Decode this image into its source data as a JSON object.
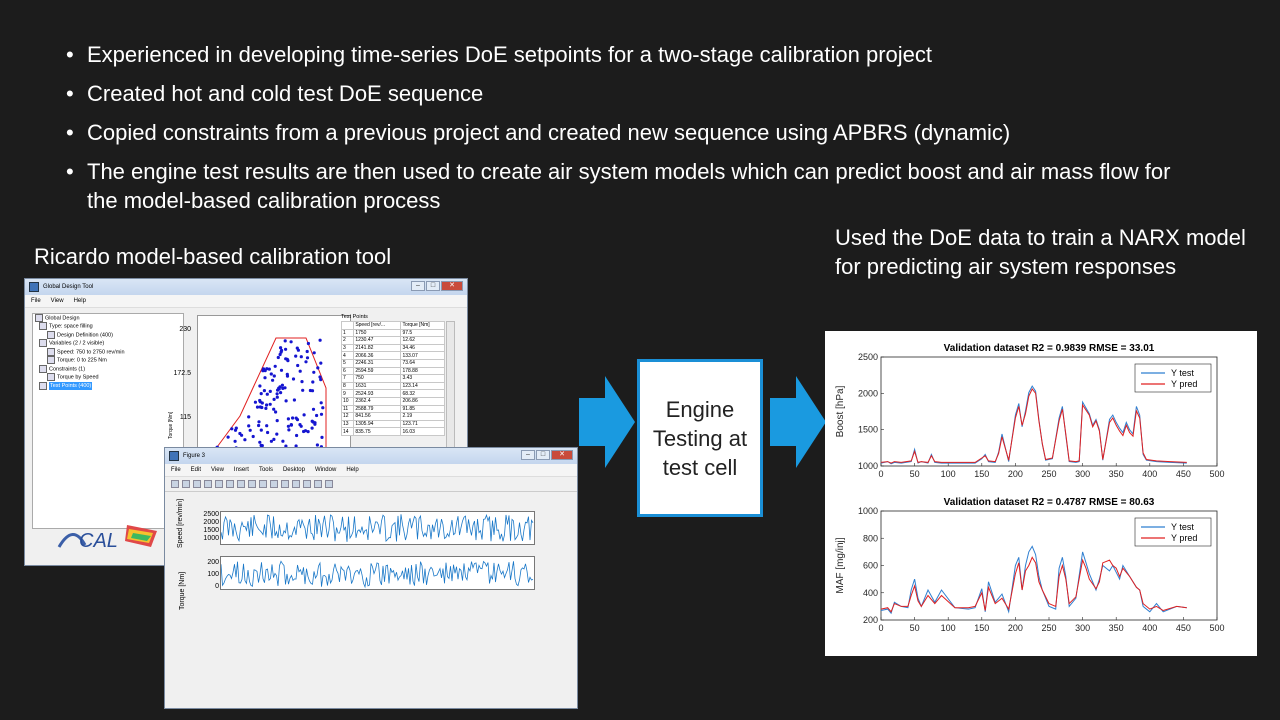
{
  "bullets": [
    "Experienced in developing time-series DoE setpoints for a two-stage calibration project",
    "Created hot and cold test DoE sequence",
    "Copied constraints from a previous project and created new sequence using APBRS (dynamic)",
    "The engine test results are then used to create air system models which can predict boost and air mass flow for the model-based calibration process"
  ],
  "left_caption": "Ricardo model-based calibration tool",
  "right_caption": "Used the DoE data to train a NARX model for predicting air system responses",
  "engine_box": "Engine Testing at test cell",
  "colors": {
    "background": "#1c1c1c",
    "arrow": "#1a9ae0",
    "series_test": "#2f7fd0",
    "series_pred": "#e02020"
  },
  "gdt_window": {
    "title": "Global Design Tool",
    "menu": [
      "File",
      "View",
      "Help"
    ],
    "tree": [
      "Global Design",
      "Type: space filling",
      "Design Definition (400)",
      "Variables (2 / 2 visible)",
      "Speed: 750 to 2750 rev/min",
      "Torque: 0 to 225 Nm",
      "Constraints (1)",
      "Torque by Speed",
      "Test Points (400)"
    ],
    "scatter_yticks": [
      "230",
      "172.5",
      "115"
    ],
    "scatter_ylabel": "Torque [Nm]",
    "logo_text": "CAL",
    "test_points_title": "Test Points",
    "test_points_columns": [
      "",
      "Speed [rev/...",
      "Torque [Nm]"
    ],
    "test_points_rows": [
      [
        "1",
        "1750",
        "97.5"
      ],
      [
        "2",
        "1230.47",
        "12.62"
      ],
      [
        "3",
        "2141.82",
        "34.46"
      ],
      [
        "4",
        "2066.36",
        "133.07"
      ],
      [
        "5",
        "2246.31",
        "73.64"
      ],
      [
        "6",
        "2594.59",
        "178.88"
      ],
      [
        "7",
        "750",
        "3.43"
      ],
      [
        "8",
        "1631",
        "123.14"
      ],
      [
        "9",
        "2524.93",
        "68.32"
      ],
      [
        "10",
        "2362.4",
        "206.86"
      ],
      [
        "11",
        "2588.79",
        "91.85"
      ],
      [
        "12",
        "841.56",
        "2.19"
      ],
      [
        "13",
        "1305.94",
        "123.71"
      ],
      [
        "14",
        "835.75",
        "16.03"
      ]
    ]
  },
  "fig3_window": {
    "title": "Figure 3",
    "menu": [
      "File",
      "Edit",
      "View",
      "Insert",
      "Tools",
      "Desktop",
      "Window",
      "Help"
    ],
    "speed_ylabel": "Speed\n[rev/min]",
    "speed_ticks": [
      "2500",
      "2000",
      "1500",
      "1000"
    ],
    "torque_ylabel": "Torque\n[Nm]",
    "torque_ticks": [
      "200",
      "100",
      "0"
    ]
  },
  "chart_data": [
    {
      "type": "line",
      "title": "Validation dataset R2 = 0.9839 RMSE = 33.01",
      "xlabel": "",
      "ylabel": "Boost [hPa]",
      "xlim": [
        0,
        500
      ],
      "ylim": [
        1000,
        2500
      ],
      "xticks": [
        0,
        50,
        100,
        150,
        200,
        250,
        300,
        350,
        400,
        450,
        500
      ],
      "yticks": [
        1000,
        1500,
        2000,
        2500
      ],
      "legend": "top-right",
      "grid": false,
      "series": [
        {
          "name": "Y test",
          "x": [
            0,
            10,
            15,
            20,
            30,
            45,
            50,
            55,
            60,
            70,
            75,
            80,
            90,
            110,
            140,
            150,
            155,
            160,
            170,
            175,
            180,
            190,
            200,
            205,
            210,
            215,
            220,
            225,
            230,
            235,
            240,
            245,
            255,
            265,
            270,
            275,
            280,
            290,
            295,
            300,
            310,
            315,
            320,
            325,
            330,
            340,
            345,
            350,
            355,
            360,
            365,
            370,
            375,
            380,
            385,
            390,
            395,
            410,
            430,
            455
          ],
          "y": [
            1040,
            1060,
            1030,
            1050,
            1040,
            1060,
            1230,
            1040,
            1060,
            1040,
            1160,
            1050,
            1040,
            1040,
            1040,
            1100,
            1160,
            1060,
            1050,
            1190,
            1440,
            1060,
            1700,
            1860,
            1540,
            1760,
            2010,
            2100,
            2030,
            1640,
            1300,
            1080,
            1100,
            1660,
            1820,
            1420,
            1060,
            1050,
            1060,
            1880,
            1720,
            1560,
            1640,
            1500,
            1080,
            1640,
            1700,
            1600,
            1520,
            1460,
            1600,
            1500,
            1440,
            1820,
            1700,
            1160,
            1080,
            1060,
            1050,
            1040
          ]
        },
        {
          "name": "Y pred",
          "x": [
            0,
            10,
            15,
            20,
            30,
            45,
            50,
            55,
            60,
            70,
            75,
            80,
            90,
            110,
            140,
            150,
            155,
            160,
            170,
            175,
            180,
            190,
            200,
            205,
            210,
            215,
            220,
            225,
            230,
            235,
            240,
            245,
            255,
            265,
            270,
            275,
            280,
            290,
            295,
            300,
            310,
            315,
            320,
            325,
            330,
            340,
            345,
            350,
            355,
            360,
            365,
            370,
            375,
            380,
            385,
            390,
            395,
            410,
            430,
            455
          ],
          "y": [
            1050,
            1060,
            1040,
            1060,
            1050,
            1070,
            1200,
            1050,
            1060,
            1050,
            1140,
            1060,
            1050,
            1050,
            1050,
            1110,
            1140,
            1070,
            1060,
            1170,
            1400,
            1080,
            1660,
            1820,
            1560,
            1720,
            1960,
            2060,
            2000,
            1620,
            1310,
            1090,
            1110,
            1620,
            1780,
            1440,
            1070,
            1060,
            1070,
            1840,
            1700,
            1540,
            1620,
            1480,
            1090,
            1600,
            1660,
            1560,
            1480,
            1420,
            1560,
            1460,
            1410,
            1760,
            1660,
            1180,
            1090,
            1070,
            1060,
            1050
          ]
        }
      ]
    },
    {
      "type": "line",
      "title": "Validation dataset R2 = 0.4787 RMSE = 80.63",
      "xlabel": "",
      "ylabel": "MAF [mg/inj]",
      "xlim": [
        0,
        500
      ],
      "ylim": [
        200,
        1000
      ],
      "xticks": [
        0,
        50,
        100,
        150,
        200,
        250,
        300,
        350,
        400,
        450,
        500
      ],
      "yticks": [
        200,
        400,
        600,
        800,
        1000
      ],
      "legend": "top-right",
      "grid": false,
      "series": [
        {
          "name": "Y test",
          "x": [
            0,
            10,
            15,
            20,
            30,
            40,
            45,
            50,
            55,
            60,
            70,
            80,
            90,
            110,
            130,
            140,
            150,
            155,
            160,
            170,
            180,
            190,
            200,
            205,
            210,
            215,
            220,
            225,
            230,
            235,
            240,
            250,
            260,
            265,
            270,
            275,
            280,
            290,
            300,
            305,
            310,
            320,
            325,
            330,
            340,
            345,
            350,
            355,
            360,
            370,
            380,
            385,
            390,
            400,
            410,
            420,
            440,
            455
          ],
          "y": [
            270,
            280,
            250,
            330,
            300,
            290,
            420,
            500,
            360,
            300,
            420,
            330,
            420,
            290,
            280,
            290,
            430,
            260,
            480,
            330,
            390,
            260,
            600,
            660,
            420,
            600,
            700,
            740,
            680,
            520,
            420,
            300,
            280,
            580,
            660,
            520,
            300,
            360,
            700,
            620,
            540,
            420,
            500,
            600,
            560,
            600,
            550,
            500,
            600,
            520,
            440,
            420,
            300,
            260,
            320,
            260,
            300,
            290
          ]
        },
        {
          "name": "Y pred",
          "x": [
            0,
            10,
            15,
            20,
            30,
            40,
            45,
            50,
            55,
            60,
            70,
            80,
            90,
            110,
            130,
            140,
            150,
            155,
            160,
            170,
            180,
            190,
            200,
            205,
            210,
            215,
            220,
            225,
            230,
            235,
            240,
            250,
            260,
            265,
            270,
            275,
            280,
            290,
            300,
            305,
            310,
            320,
            325,
            330,
            340,
            345,
            350,
            355,
            360,
            370,
            380,
            385,
            390,
            400,
            410,
            420,
            440,
            455
          ],
          "y": [
            280,
            290,
            260,
            320,
            300,
            300,
            380,
            450,
            340,
            300,
            380,
            320,
            380,
            290,
            290,
            300,
            400,
            270,
            440,
            320,
            360,
            280,
            540,
            620,
            420,
            560,
            600,
            660,
            620,
            480,
            420,
            320,
            300,
            520,
            600,
            500,
            320,
            370,
            640,
            580,
            500,
            430,
            480,
            620,
            640,
            600,
            580,
            520,
            580,
            520,
            440,
            420,
            320,
            280,
            300,
            270,
            300,
            290
          ]
        }
      ]
    }
  ]
}
